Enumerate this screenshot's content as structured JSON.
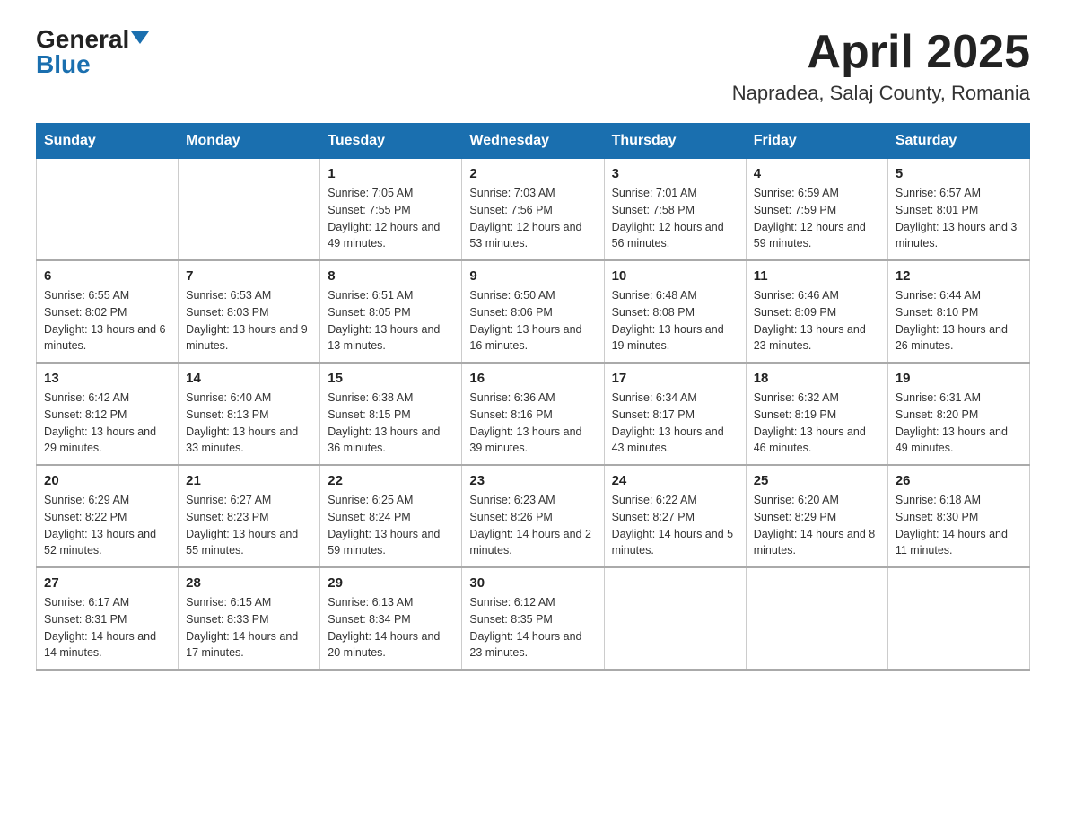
{
  "logo": {
    "general": "General",
    "blue": "Blue"
  },
  "title": {
    "month_year": "April 2025",
    "location": "Napradea, Salaj County, Romania"
  },
  "weekdays": [
    "Sunday",
    "Monday",
    "Tuesday",
    "Wednesday",
    "Thursday",
    "Friday",
    "Saturday"
  ],
  "weeks": [
    [
      null,
      null,
      {
        "day": "1",
        "sunrise": "7:05 AM",
        "sunset": "7:55 PM",
        "daylight": "12 hours and 49 minutes."
      },
      {
        "day": "2",
        "sunrise": "7:03 AM",
        "sunset": "7:56 PM",
        "daylight": "12 hours and 53 minutes."
      },
      {
        "day": "3",
        "sunrise": "7:01 AM",
        "sunset": "7:58 PM",
        "daylight": "12 hours and 56 minutes."
      },
      {
        "day": "4",
        "sunrise": "6:59 AM",
        "sunset": "7:59 PM",
        "daylight": "12 hours and 59 minutes."
      },
      {
        "day": "5",
        "sunrise": "6:57 AM",
        "sunset": "8:01 PM",
        "daylight": "13 hours and 3 minutes."
      }
    ],
    [
      {
        "day": "6",
        "sunrise": "6:55 AM",
        "sunset": "8:02 PM",
        "daylight": "13 hours and 6 minutes."
      },
      {
        "day": "7",
        "sunrise": "6:53 AM",
        "sunset": "8:03 PM",
        "daylight": "13 hours and 9 minutes."
      },
      {
        "day": "8",
        "sunrise": "6:51 AM",
        "sunset": "8:05 PM",
        "daylight": "13 hours and 13 minutes."
      },
      {
        "day": "9",
        "sunrise": "6:50 AM",
        "sunset": "8:06 PM",
        "daylight": "13 hours and 16 minutes."
      },
      {
        "day": "10",
        "sunrise": "6:48 AM",
        "sunset": "8:08 PM",
        "daylight": "13 hours and 19 minutes."
      },
      {
        "day": "11",
        "sunrise": "6:46 AM",
        "sunset": "8:09 PM",
        "daylight": "13 hours and 23 minutes."
      },
      {
        "day": "12",
        "sunrise": "6:44 AM",
        "sunset": "8:10 PM",
        "daylight": "13 hours and 26 minutes."
      }
    ],
    [
      {
        "day": "13",
        "sunrise": "6:42 AM",
        "sunset": "8:12 PM",
        "daylight": "13 hours and 29 minutes."
      },
      {
        "day": "14",
        "sunrise": "6:40 AM",
        "sunset": "8:13 PM",
        "daylight": "13 hours and 33 minutes."
      },
      {
        "day": "15",
        "sunrise": "6:38 AM",
        "sunset": "8:15 PM",
        "daylight": "13 hours and 36 minutes."
      },
      {
        "day": "16",
        "sunrise": "6:36 AM",
        "sunset": "8:16 PM",
        "daylight": "13 hours and 39 minutes."
      },
      {
        "day": "17",
        "sunrise": "6:34 AM",
        "sunset": "8:17 PM",
        "daylight": "13 hours and 43 minutes."
      },
      {
        "day": "18",
        "sunrise": "6:32 AM",
        "sunset": "8:19 PM",
        "daylight": "13 hours and 46 minutes."
      },
      {
        "day": "19",
        "sunrise": "6:31 AM",
        "sunset": "8:20 PM",
        "daylight": "13 hours and 49 minutes."
      }
    ],
    [
      {
        "day": "20",
        "sunrise": "6:29 AM",
        "sunset": "8:22 PM",
        "daylight": "13 hours and 52 minutes."
      },
      {
        "day": "21",
        "sunrise": "6:27 AM",
        "sunset": "8:23 PM",
        "daylight": "13 hours and 55 minutes."
      },
      {
        "day": "22",
        "sunrise": "6:25 AM",
        "sunset": "8:24 PM",
        "daylight": "13 hours and 59 minutes."
      },
      {
        "day": "23",
        "sunrise": "6:23 AM",
        "sunset": "8:26 PM",
        "daylight": "14 hours and 2 minutes."
      },
      {
        "day": "24",
        "sunrise": "6:22 AM",
        "sunset": "8:27 PM",
        "daylight": "14 hours and 5 minutes."
      },
      {
        "day": "25",
        "sunrise": "6:20 AM",
        "sunset": "8:29 PM",
        "daylight": "14 hours and 8 minutes."
      },
      {
        "day": "26",
        "sunrise": "6:18 AM",
        "sunset": "8:30 PM",
        "daylight": "14 hours and 11 minutes."
      }
    ],
    [
      {
        "day": "27",
        "sunrise": "6:17 AM",
        "sunset": "8:31 PM",
        "daylight": "14 hours and 14 minutes."
      },
      {
        "day": "28",
        "sunrise": "6:15 AM",
        "sunset": "8:33 PM",
        "daylight": "14 hours and 17 minutes."
      },
      {
        "day": "29",
        "sunrise": "6:13 AM",
        "sunset": "8:34 PM",
        "daylight": "14 hours and 20 minutes."
      },
      {
        "day": "30",
        "sunrise": "6:12 AM",
        "sunset": "8:35 PM",
        "daylight": "14 hours and 23 minutes."
      },
      null,
      null,
      null
    ]
  ]
}
